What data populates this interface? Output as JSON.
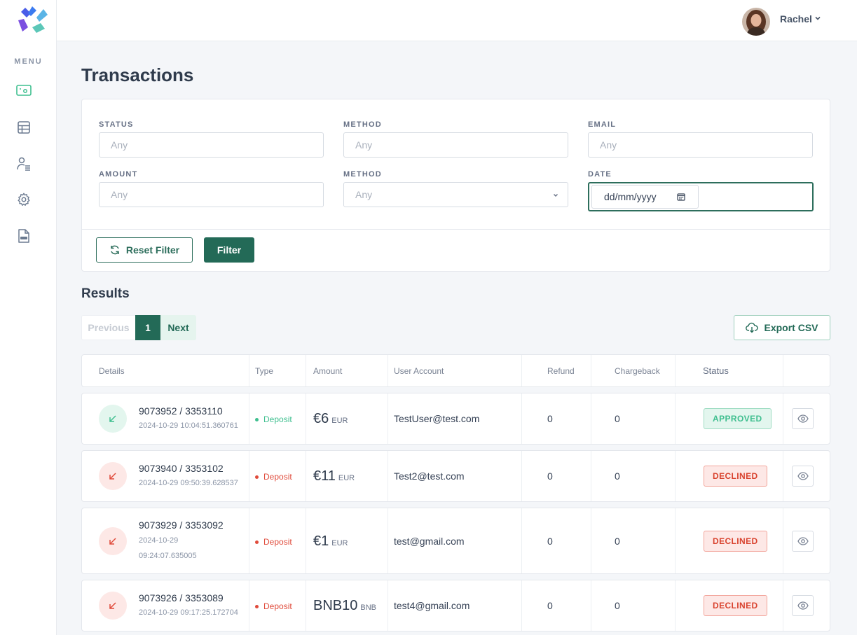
{
  "sidebar": {
    "menu_label": "MENU",
    "items": [
      {
        "icon": "money-icon",
        "active": true
      },
      {
        "icon": "table-icon"
      },
      {
        "icon": "user-list-icon"
      },
      {
        "icon": "gear-icon"
      },
      {
        "icon": "doc-file-icon"
      }
    ]
  },
  "header": {
    "user_name": "Rachel"
  },
  "page": {
    "title": "Transactions"
  },
  "filters": {
    "status_label": "STATUS",
    "status_placeholder": "Any",
    "method_label": "METHOD",
    "method_placeholder": "Any",
    "email_label": "EMAIL",
    "email_placeholder": "Any",
    "amount_label": "AMOUNT",
    "amount_placeholder": "Any",
    "method2_label": "METHOD",
    "method2_value": "Any",
    "date_label": "DATE",
    "date_placeholder": "dd/mm/yyyy",
    "reset_label": "Reset Filter",
    "filter_label": "Filter"
  },
  "results": {
    "title": "Results",
    "pager": {
      "previous": "Previous",
      "current": "1",
      "next": "Next"
    },
    "export_label": "Export CSV",
    "columns": [
      "Details",
      "Type",
      "Amount",
      "User Account",
      "Refund",
      "Chargeback",
      "Status"
    ],
    "rows": [
      {
        "id": "9073952 / 3353110",
        "date": "2024-10-29 10:04:51.360761",
        "type": "Deposit",
        "amount": "€6",
        "currency": "EUR",
        "user": "TestUser@test.com",
        "refund": "0",
        "chargeback": "0",
        "status": "APPROVED"
      },
      {
        "id": "9073940 / 3353102",
        "date": "2024-10-29 09:50:39.628537",
        "type": "Deposit",
        "amount": "€11",
        "currency": "EUR",
        "user": "Test2@test.com",
        "refund": "0",
        "chargeback": "0",
        "status": "DECLINED"
      },
      {
        "id": "9073929 / 3353092",
        "date": "2024-10-29",
        "date2": "09:24:07.635005",
        "type": "Deposit",
        "amount": "€1",
        "currency": "EUR",
        "user": "test@gmail.com",
        "refund": "0",
        "chargeback": "0",
        "status": "DECLINED"
      },
      {
        "id": "9073926 / 3353089",
        "date": "2024-10-29 09:17:25.172704",
        "type": "Deposit",
        "amount": "BNB10",
        "currency": "BNB",
        "user": "test4@gmail.com",
        "refund": "0",
        "chargeback": "0",
        "status": "DECLINED"
      }
    ]
  },
  "colors": {
    "primary": "#236a57",
    "approved": "#3fbf8f",
    "declined": "#e04b3b"
  }
}
